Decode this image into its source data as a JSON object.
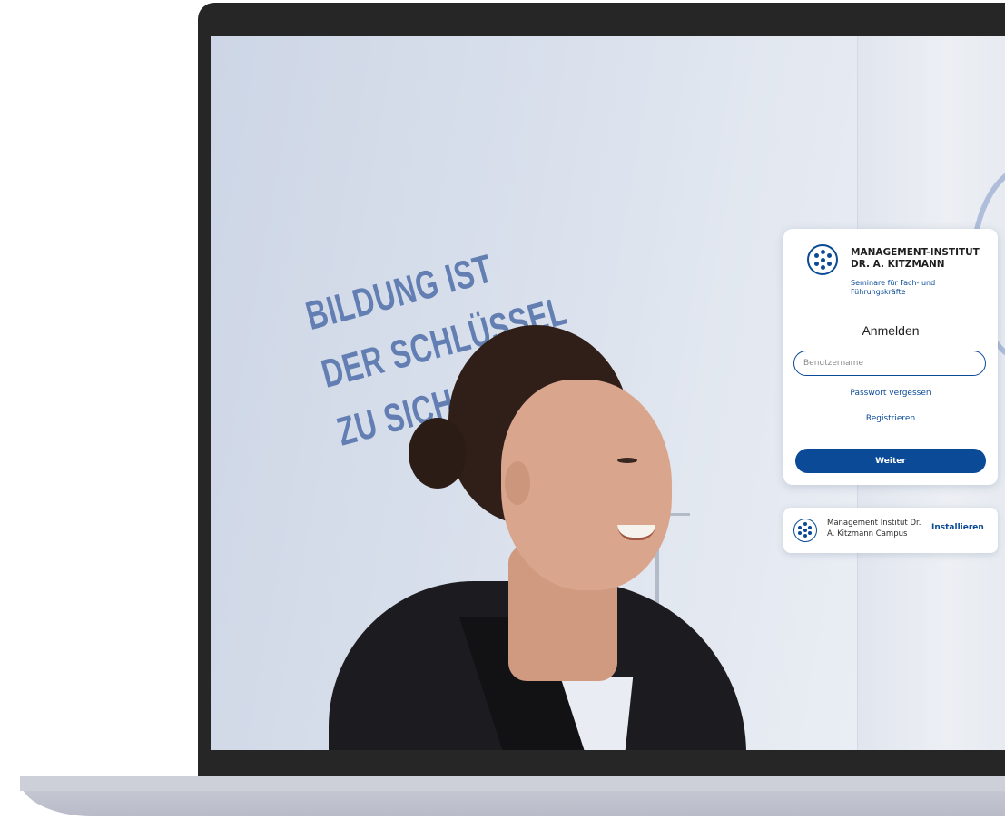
{
  "brand": {
    "title_line1": "MANAGEMENT-INSTITUT",
    "title_line2": "DR. A. KITZMANN",
    "subtitle_line1": "Seminare für Fach- und",
    "subtitle_line2": "Führungskräfte"
  },
  "login": {
    "heading": "Anmelden",
    "username_placeholder": "Benutzername",
    "forgot_password": "Passwort vergessen",
    "register": "Registrieren",
    "continue_button": "Weiter"
  },
  "install_banner": {
    "app_name_line1": "Management Institut Dr.",
    "app_name_line2": "A. Kitzmann Campus",
    "install_button": "Installieren"
  },
  "background": {
    "slogan_line1": "BILDUNG IST",
    "slogan_line2": "DER SCHLÜSSEL",
    "slogan_line3": "ZU SICH S"
  },
  "colors": {
    "accent": "#0a4a96",
    "laptop_frame": "#262626",
    "card_background": "#ffffff"
  },
  "icons": {
    "logo": "dotted-circle-logo-icon",
    "install_app": "dotted-circle-app-icon"
  }
}
